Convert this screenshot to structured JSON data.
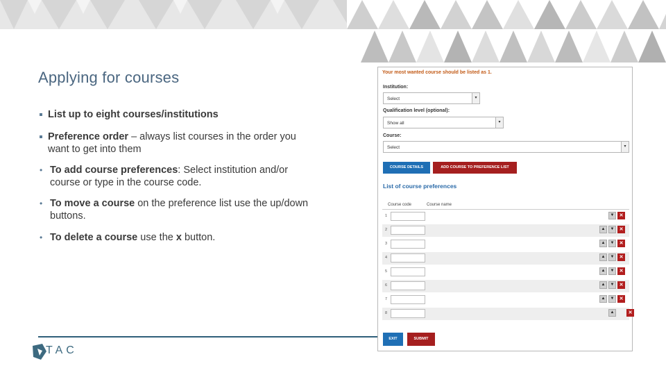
{
  "slide": {
    "title": "Applying for courses",
    "bullets": [
      {
        "bold": "List up to eight courses/institutions",
        "text": ""
      },
      {
        "bold": "Preference order",
        "text": " – always list courses in the order you",
        "text2": "want to get into them"
      }
    ],
    "sub_bullets": [
      {
        "bold": "To add course preferences",
        "text": ": Select institution and/or",
        "text2": "course or type in the course code."
      },
      {
        "bold": "To move a course",
        "text": " on the preference list use the up/down",
        "text2": "buttons."
      },
      {
        "bold": "To delete a course",
        "text": " use the ",
        "bold2": "x",
        "text3": " button."
      }
    ],
    "logo_text": "TAC"
  },
  "form": {
    "warning": "Your most wanted course should be listed as 1.",
    "institution": {
      "label": "Institution:",
      "value": "Select"
    },
    "qualification": {
      "label": "Qualification level (optional):",
      "value": "Show all"
    },
    "course": {
      "label": "Course:",
      "value": "Select"
    },
    "course_details_btn": "COURSE DETAILS",
    "add_btn": "ADD COURSE TO PREFERENCE LIST",
    "list_title": "List of course preferences",
    "col_code": "Course code",
    "col_name": "Course name",
    "rows": [
      {
        "n": "1"
      },
      {
        "n": "2"
      },
      {
        "n": "3"
      },
      {
        "n": "4"
      },
      {
        "n": "5"
      },
      {
        "n": "6"
      },
      {
        "n": "7"
      },
      {
        "n": "8"
      }
    ],
    "up_glyph": "▲",
    "down_glyph": "▼",
    "del_glyph": "✕",
    "exit_btn": "EXIT",
    "submit_btn": "SUBMIT"
  },
  "colors": {
    "title": "#4a6680",
    "blue_btn": "#1f6fb5",
    "red_btn": "#a51f1f",
    "warning": "#c25a16"
  }
}
